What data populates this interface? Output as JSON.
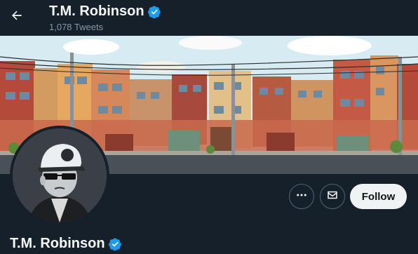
{
  "header": {
    "name": "T.M. Robinson",
    "tweet_count": "1,078 Tweets"
  },
  "profile": {
    "display_name": "T.M. Robinson",
    "verified": true
  },
  "actions": {
    "more_icon": "more-icon",
    "message_icon": "envelope-icon",
    "follow_label": "Follow"
  },
  "colors": {
    "background": "#15202b",
    "verified_blue": "#1d9bf0",
    "secondary_text": "#8b98a5",
    "follow_bg": "#eff3f4"
  }
}
